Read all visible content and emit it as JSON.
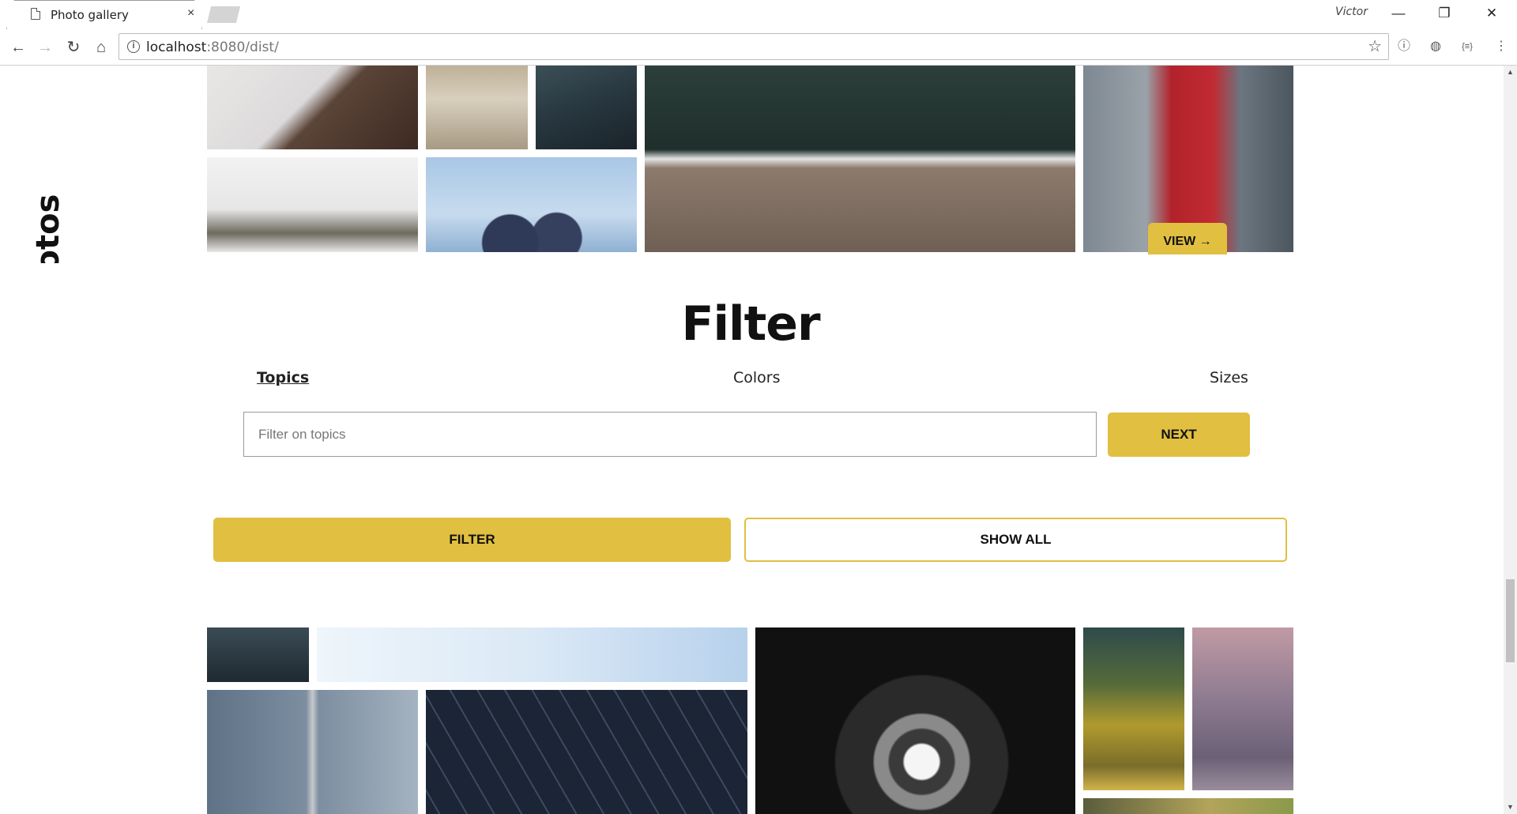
{
  "browser": {
    "tab_title": "Photo gallery",
    "tab_close": "×",
    "user": "Victor",
    "url_host": "localhost",
    "url_path": ":8080/dist/",
    "window_controls": {
      "minimize": "—",
      "restore": "❐",
      "close": "✕"
    },
    "icons": [
      "page-icon",
      "back-icon",
      "forward-icon",
      "reload-icon",
      "home-icon",
      "info-icon",
      "star-icon",
      "extension-icon"
    ]
  },
  "page": {
    "side_label": "n photos",
    "view_button": "VIEW →",
    "filter_heading": "Filter",
    "filter_tabs": [
      {
        "label": "Topics",
        "active": true
      },
      {
        "label": "Colors",
        "active": false
      },
      {
        "label": "Sizes",
        "active": false
      }
    ],
    "filter_input_placeholder": "Filter on topics",
    "next_button": "NEXT",
    "filter_button": "FILTER",
    "show_all_button": "SHOW ALL"
  },
  "colors": {
    "accent": "#e1bf41",
    "text": "#111111"
  }
}
